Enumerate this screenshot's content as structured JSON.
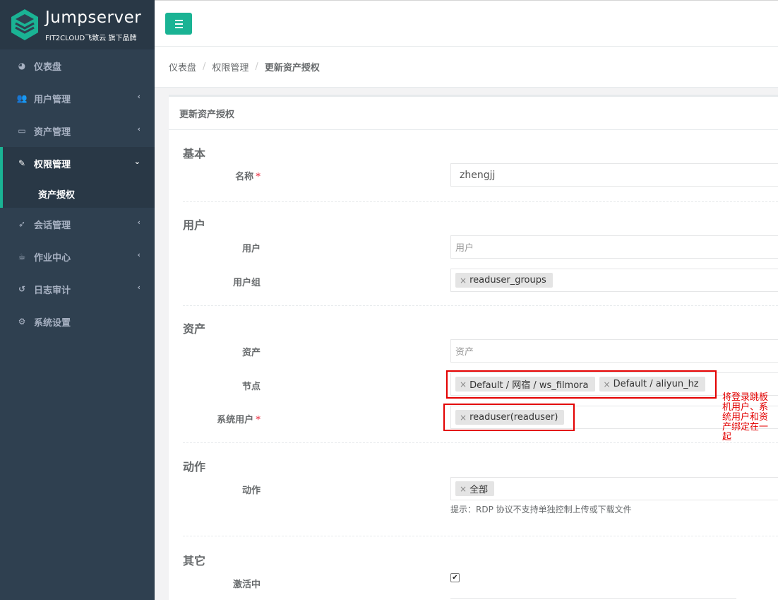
{
  "brand": {
    "title": "Jumpserver",
    "subtitle": "FIT2CLOUD飞致云 旗下品牌"
  },
  "sidebar": {
    "items": [
      {
        "label": "仪表盘",
        "icon": "dashboard-icon"
      },
      {
        "label": "用户管理",
        "icon": "users-icon"
      },
      {
        "label": "资产管理",
        "icon": "inbox-icon"
      },
      {
        "label": "权限管理",
        "icon": "edit-icon"
      },
      {
        "label": "会话管理",
        "icon": "rocket-icon"
      },
      {
        "label": "作业中心",
        "icon": "coffee-icon"
      },
      {
        "label": "日志审计",
        "icon": "history-icon"
      },
      {
        "label": "系统设置",
        "icon": "gears-icon"
      }
    ],
    "sub_item": "资产授权"
  },
  "breadcrumb": {
    "home": "仪表盘",
    "parent": "权限管理",
    "current": "更新资产授权"
  },
  "panel": {
    "title": "更新资产授权"
  },
  "form": {
    "sections": {
      "basic": "基本",
      "user": "用户",
      "asset": "资产",
      "action": "动作",
      "other": "其它"
    },
    "name": {
      "label": "名称",
      "value": "zhengjj"
    },
    "users": {
      "label": "用户",
      "placeholder": "用户"
    },
    "user_groups": {
      "label": "用户组",
      "tags": [
        "readuser_groups"
      ]
    },
    "assets": {
      "label": "资产",
      "placeholder": "资产"
    },
    "nodes": {
      "label": "节点",
      "tags": [
        "Default / 网宿 / ws_filmora",
        "Default / aliyun_hz"
      ]
    },
    "system_users": {
      "label": "系统用户",
      "tags": [
        "readuser(readuser)"
      ]
    },
    "actions": {
      "label": "动作",
      "tags": [
        "全部"
      ],
      "hint": "提示：RDP 协议不支持单独控制上传或下载文件"
    },
    "active": {
      "label": "激活中",
      "checked": true
    },
    "required_mark": "*"
  },
  "annotation": "将登录跳板机用户、系统用户和资产绑定在一起",
  "colors": {
    "sidebar": "#2f4050",
    "accent": "#1ab394",
    "annotation": "#e30000"
  }
}
